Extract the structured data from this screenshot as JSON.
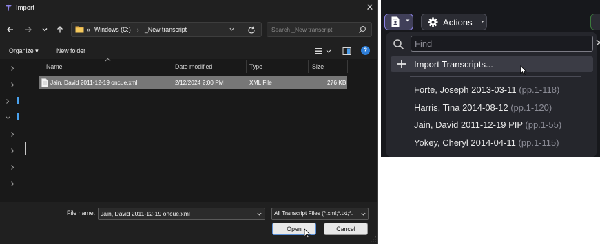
{
  "dialog": {
    "title": "Import",
    "close_glyph": "✕",
    "address": {
      "overflow": "«",
      "drive": "Windows (C:)",
      "separator": "›",
      "folder": "_New transcript"
    },
    "search_placeholder": "Search _New transcript",
    "toolbar": {
      "organize": "Organize ▾",
      "new_folder": "New folder"
    },
    "columns": {
      "name": "Name",
      "date": "Date modified",
      "type": "Type",
      "size": "Size"
    },
    "files": [
      {
        "name": "Jain, David 2011-12-19 oncue.xml",
        "date": "2/12/2024 2:00 PM",
        "type": "XML File",
        "size": "276 KB"
      }
    ],
    "file_name_label": "File name:",
    "file_name_value": "Jain, David 2011-12-19 oncue.xml",
    "file_type_value": "All Transcript Files (*.xml;*.txt;*.",
    "open_label": "Open",
    "cancel_label": "Cancel",
    "help_glyph": "?"
  },
  "panel": {
    "actions_label": "Actions",
    "find_placeholder": "Find",
    "import_label": "Import Transcripts...",
    "transcripts": [
      {
        "name": "Forte, Joseph 2013-03-11",
        "pages": "(pp.1-118)"
      },
      {
        "name": "Harris, Tina 2014-08-12",
        "pages": "(pp.1-120)"
      },
      {
        "name": "Jain, David 2011-12-19 PIP",
        "pages": "(pp.1-55)"
      },
      {
        "name": "Yokey, Cheryl 2014-04-11",
        "pages": "(pp.1-115)"
      }
    ],
    "accent_color": "#8c82e6"
  }
}
